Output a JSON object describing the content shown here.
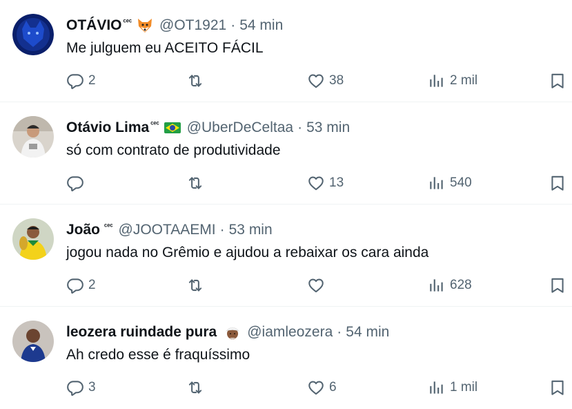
{
  "tweets": [
    {
      "name": "OTÁVIO",
      "name_suffix": "ᶜᵉᶜ",
      "emoji": "fox-face",
      "handle": "@OT1921",
      "separator": "·",
      "time": "54 min",
      "text": "Me julguem eu ACEITO FÁCIL",
      "replies": "2",
      "retweets": "",
      "likes": "38",
      "views": "2 mil"
    },
    {
      "name": "Otávio Lima",
      "name_suffix": "ᶜᵉᶜ",
      "emoji": "brazil-flag",
      "handle": "@UberDeCeltaa",
      "separator": "·",
      "time": "53 min",
      "text": "só com contrato de produtividade",
      "replies": "",
      "retweets": "",
      "likes": "13",
      "views": "540"
    },
    {
      "name": "João",
      "name_suffix": "ᶜᵉᶜ",
      "emoji": "",
      "handle": "@JOOTAAEMI",
      "separator": "·",
      "time": "53 min",
      "text": "jogou nada no Grêmio e ajudou a rebaixar os cara ainda",
      "replies": "2",
      "retweets": "",
      "likes": "",
      "views": "628"
    },
    {
      "name": "leozera ruindade pura",
      "name_suffix": "",
      "emoji": "person-white-turban",
      "handle": "@iamleozera",
      "separator": "·",
      "time": "54 min",
      "text": "Ah credo esse é fraquíssimo",
      "replies": "3",
      "retweets": "",
      "likes": "6",
      "views": "1 mil"
    }
  ],
  "colors": {
    "text": "#0f1419",
    "secondary": "#536471",
    "divider": "#eff3f4"
  },
  "icons": [
    "reply-icon",
    "retweet-icon",
    "like-icon",
    "views-icon",
    "bookmark-icon"
  ]
}
